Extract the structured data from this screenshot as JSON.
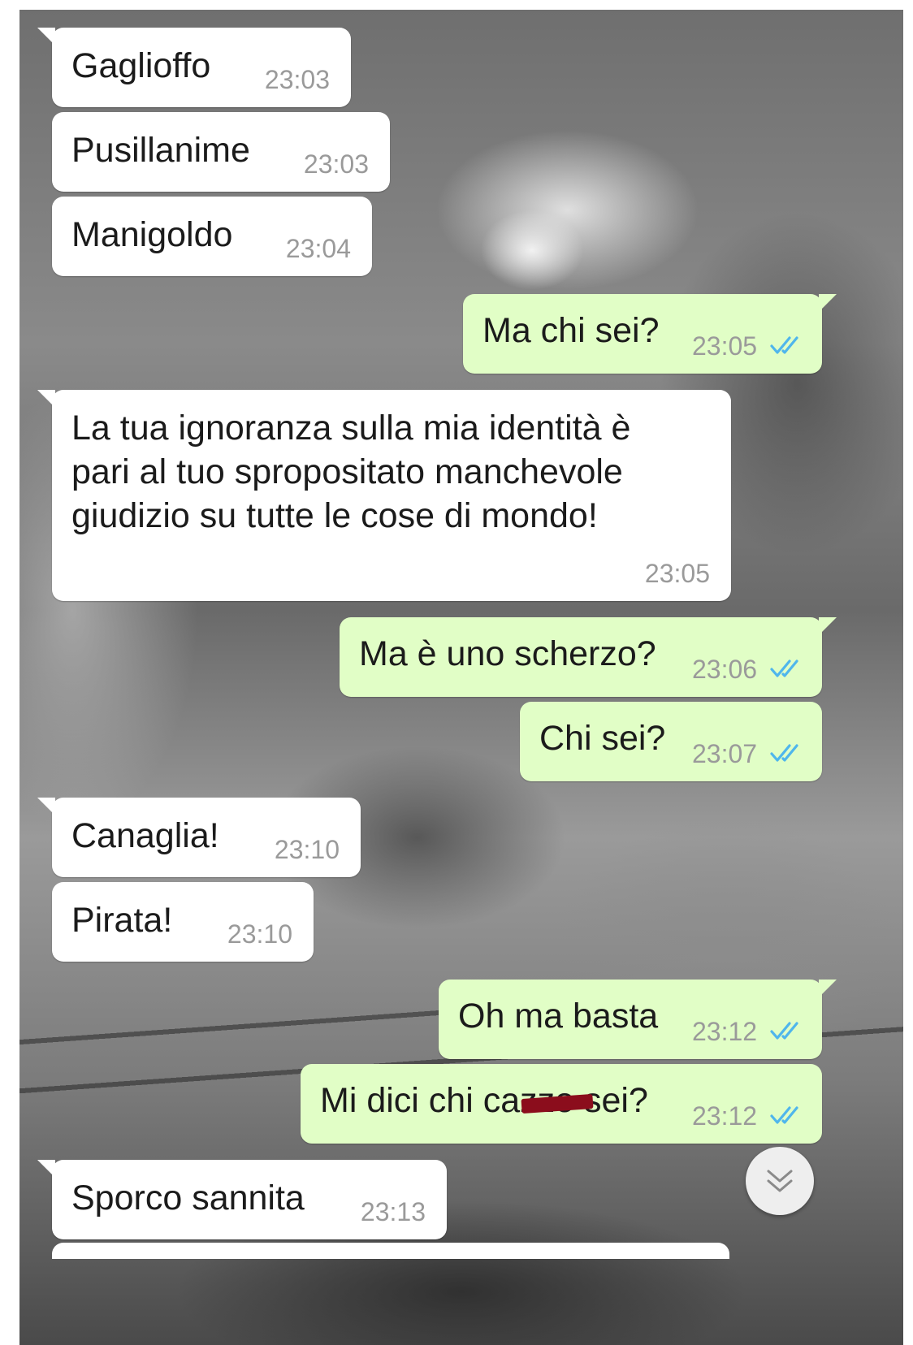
{
  "chat": {
    "messages": [
      {
        "direction": "incoming",
        "text": "Gaglioffo",
        "time": "23:03"
      },
      {
        "direction": "incoming",
        "text": "Pusillanime",
        "time": "23:03"
      },
      {
        "direction": "incoming",
        "text": "Manigoldo",
        "time": "23:04"
      },
      {
        "direction": "outgoing",
        "text": "Ma chi sei?",
        "time": "23:05",
        "status": "read"
      },
      {
        "direction": "incoming",
        "text": "La tua ignoranza sulla mia identità è pari al tuo spropositato manchevole giudizio su tutte le cose di mondo!",
        "time": "23:05"
      },
      {
        "direction": "outgoing",
        "text": "Ma è uno scherzo?",
        "time": "23:06",
        "status": "read"
      },
      {
        "direction": "outgoing",
        "text": "Chi sei?",
        "time": "23:07",
        "status": "read"
      },
      {
        "direction": "incoming",
        "text": "Canaglia!",
        "time": "23:10"
      },
      {
        "direction": "incoming",
        "text": "Pirata!",
        "time": "23:10"
      },
      {
        "direction": "outgoing",
        "text": "Oh ma basta",
        "time": "23:12",
        "status": "read"
      },
      {
        "direction": "outgoing",
        "text_before": "Mi dici chi ca",
        "text_redacted": "zzo",
        "text_after": " sei?",
        "time": "23:12",
        "status": "read"
      },
      {
        "direction": "incoming",
        "text": "Sporco sannita",
        "time": "23:13"
      }
    ]
  },
  "icons": {
    "read_receipt": "double-check-icon",
    "scroll_down": "double-chevron-down-icon"
  },
  "colors": {
    "incoming_bubble": "#ffffff",
    "outgoing_bubble": "#e1fec6",
    "read_ticks": "#4fb6ec",
    "redaction": "#8b0d1c"
  }
}
